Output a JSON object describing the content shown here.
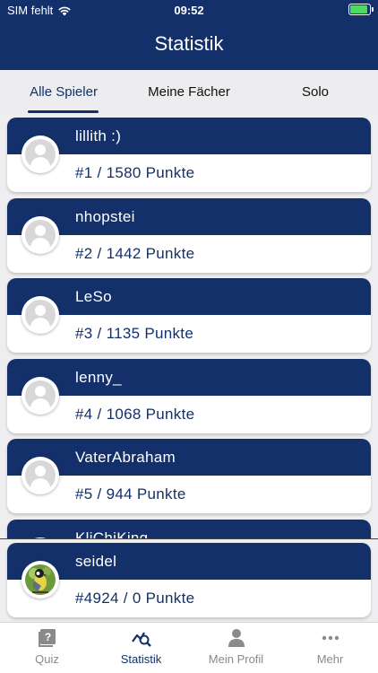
{
  "status_bar": {
    "carrier": "SIM fehlt",
    "time": "09:52"
  },
  "header": {
    "title": "Statistik"
  },
  "tabs": [
    {
      "label": "Alle Spieler",
      "active": true
    },
    {
      "label": "Meine Fächer",
      "active": false
    },
    {
      "label": "Solo",
      "active": false
    }
  ],
  "players": [
    {
      "name": "lillith :)",
      "rank": "#1 / 1580 Punkte"
    },
    {
      "name": "nhopstei",
      "rank": "#2 / 1442 Punkte"
    },
    {
      "name": "LeSo",
      "rank": "#3 / 1135 Punkte"
    },
    {
      "name": "lenny_",
      "rank": "#4 / 1068 Punkte"
    },
    {
      "name": "VaterAbraham",
      "rank": "#5 / 944 Punkte"
    },
    {
      "name": "KliChiKing",
      "rank": ""
    }
  ],
  "self": {
    "name": "seidel",
    "rank": "#4924 / 0 Punkte",
    "avatar": "bird-photo"
  },
  "tabbar": [
    {
      "label": "Quiz",
      "icon": "question-book-icon"
    },
    {
      "label": "Statistik",
      "icon": "chart-magnifier-icon",
      "active": true
    },
    {
      "label": "Mein Profil",
      "icon": "person-icon"
    },
    {
      "label": "Mehr",
      "icon": "more-dots-icon"
    }
  ],
  "colors": {
    "primary": "#14306a",
    "background": "#eeeef0",
    "inactive": "#8a8a8a"
  }
}
